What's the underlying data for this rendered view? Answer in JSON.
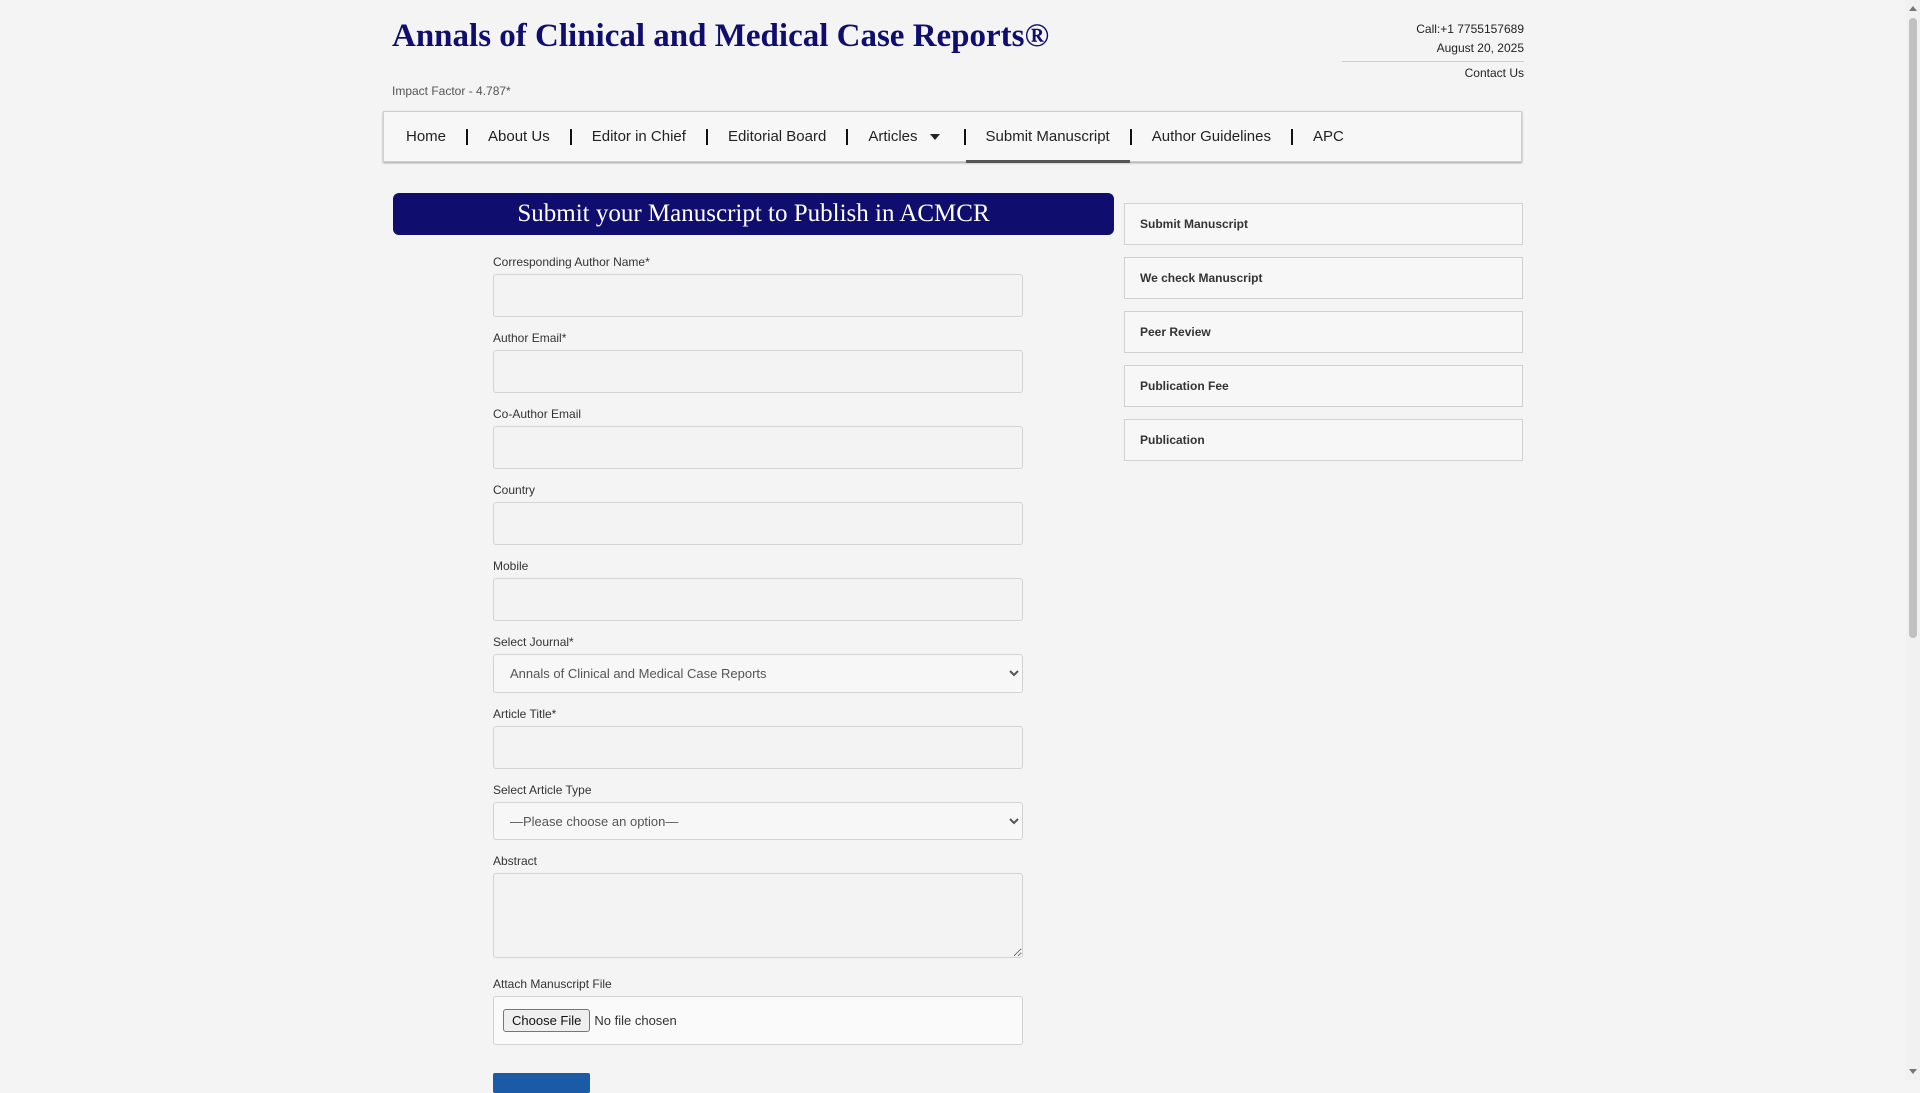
{
  "header": {
    "title": "Annals of Clinical and Medical Case Reports®",
    "impact_factor": "Impact Factor - 4.787*",
    "phone": "Call:+1 7755157689",
    "date": "August 20, 2025",
    "contact_link": "Contact Us"
  },
  "nav": {
    "items": [
      {
        "label": "Home"
      },
      {
        "label": "About Us"
      },
      {
        "label": "Editor in Chief"
      },
      {
        "label": "Editorial Board"
      },
      {
        "label": "Articles"
      },
      {
        "label": "Submit Manuscript"
      },
      {
        "label": "Author Guidelines"
      },
      {
        "label": "APC"
      }
    ],
    "active": "Submit Manuscript"
  },
  "banner": {
    "title": "Submit your Manuscript to Publish in ACMCR"
  },
  "form": {
    "author_name_label": "Corresponding Author Name*",
    "author_email_label": "Author Email*",
    "coauthor_email_label": "Co-Author Email",
    "country_label": "Country",
    "mobile_label": "Mobile",
    "journal_label": "Select Journal*",
    "journal_value": "Annals of Clinical and Medical Case Reports",
    "article_title_label": "Article Title*",
    "article_type_label": "Select Article Type",
    "article_type_value": "—Please choose an option—",
    "abstract_label": "Abstract",
    "file_label": "Attach Manuscript File",
    "file_button": "Choose File",
    "file_status": "No file chosen"
  },
  "sidebar": {
    "items": [
      {
        "label": "Submit Manuscript"
      },
      {
        "label": "We check Manuscript"
      },
      {
        "label": "Peer Review"
      },
      {
        "label": "Publication Fee"
      },
      {
        "label": "Publication"
      }
    ]
  },
  "colors": {
    "brand": "#0f0e6e",
    "submit_button": "#1a5aa6",
    "background": "#f4f4f4"
  }
}
